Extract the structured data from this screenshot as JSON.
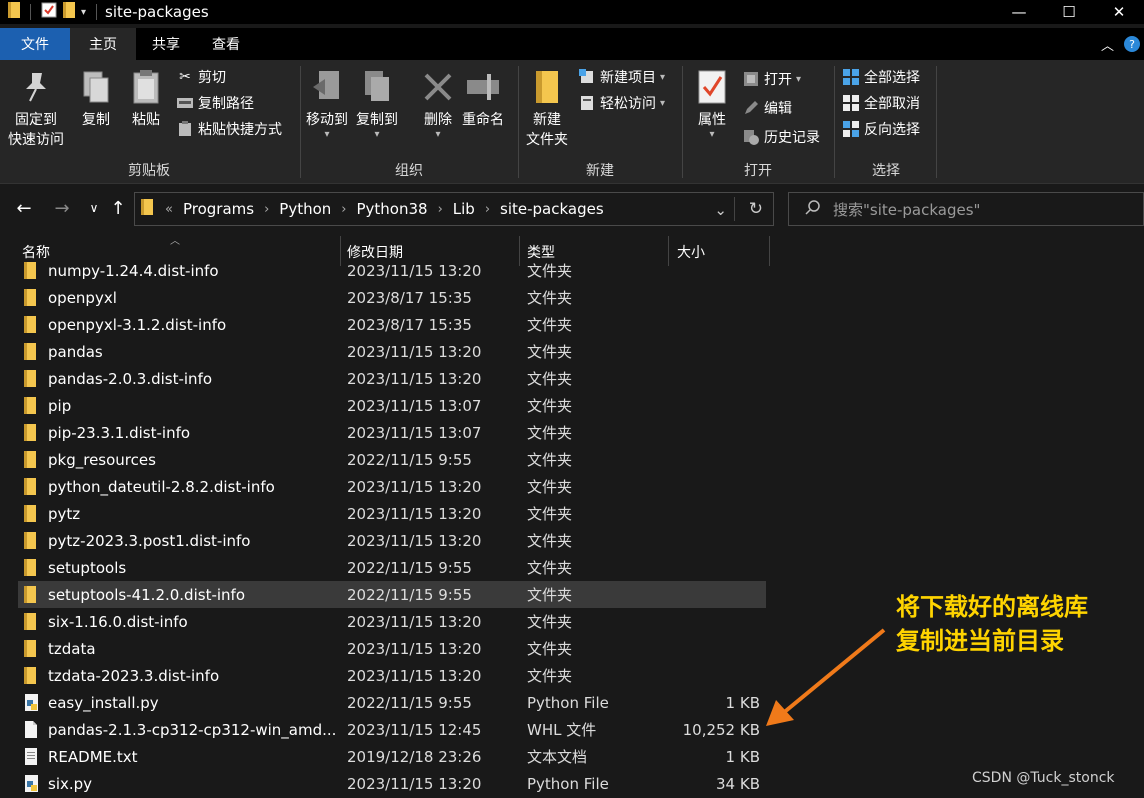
{
  "window": {
    "title": "site-packages",
    "controls": [
      "—",
      "☐",
      "✕"
    ]
  },
  "ribbon_tabs": {
    "file": "文件",
    "home": "主页",
    "share": "共享",
    "view": "查看"
  },
  "ribbon": {
    "clipboard": {
      "label": "剪贴板",
      "pin": "固定到\n快速访问",
      "pin_l1": "固定到",
      "pin_l2": "快速访问",
      "copy": "复制",
      "paste": "粘贴",
      "cut": "剪切",
      "copy_path": "复制路径",
      "paste_shortcut": "粘贴快捷方式"
    },
    "organize": {
      "label": "组织",
      "move_to": "移动到",
      "copy_to": "复制到",
      "delete": "删除",
      "rename": "重命名"
    },
    "new": {
      "label": "新建",
      "new_folder_l1": "新建",
      "new_folder_l2": "文件夹",
      "new_item": "新建项目",
      "easy_access": "轻松访问"
    },
    "open": {
      "label": "打开",
      "properties": "属性",
      "open": "打开",
      "edit": "编辑",
      "history": "历史记录"
    },
    "select": {
      "label": "选择",
      "select_all": "全部选择",
      "select_none": "全部取消",
      "invert": "反向选择"
    }
  },
  "address": {
    "prefix": "«",
    "crumbs": [
      "Programs",
      "Python",
      "Python38",
      "Lib",
      "site-packages"
    ]
  },
  "search": {
    "placeholder": "搜索\"site-packages\""
  },
  "columns": {
    "name": "名称",
    "date": "修改日期",
    "type": "类型",
    "size": "大小"
  },
  "files": [
    {
      "name": "numpy-1.24.4.dist-info",
      "date": "2023/11/15 13:20",
      "type": "文件夹",
      "size": "",
      "kind": "folder"
    },
    {
      "name": "openpyxl",
      "date": "2023/8/17 15:35",
      "type": "文件夹",
      "size": "",
      "kind": "folder"
    },
    {
      "name": "openpyxl-3.1.2.dist-info",
      "date": "2023/8/17 15:35",
      "type": "文件夹",
      "size": "",
      "kind": "folder"
    },
    {
      "name": "pandas",
      "date": "2023/11/15 13:20",
      "type": "文件夹",
      "size": "",
      "kind": "folder"
    },
    {
      "name": "pandas-2.0.3.dist-info",
      "date": "2023/11/15 13:20",
      "type": "文件夹",
      "size": "",
      "kind": "folder"
    },
    {
      "name": "pip",
      "date": "2023/11/15 13:07",
      "type": "文件夹",
      "size": "",
      "kind": "folder"
    },
    {
      "name": "pip-23.3.1.dist-info",
      "date": "2023/11/15 13:07",
      "type": "文件夹",
      "size": "",
      "kind": "folder"
    },
    {
      "name": "pkg_resources",
      "date": "2022/11/15 9:55",
      "type": "文件夹",
      "size": "",
      "kind": "folder"
    },
    {
      "name": "python_dateutil-2.8.2.dist-info",
      "date": "2023/11/15 13:20",
      "type": "文件夹",
      "size": "",
      "kind": "folder"
    },
    {
      "name": "pytz",
      "date": "2023/11/15 13:20",
      "type": "文件夹",
      "size": "",
      "kind": "folder"
    },
    {
      "name": "pytz-2023.3.post1.dist-info",
      "date": "2023/11/15 13:20",
      "type": "文件夹",
      "size": "",
      "kind": "folder"
    },
    {
      "name": "setuptools",
      "date": "2022/11/15 9:55",
      "type": "文件夹",
      "size": "",
      "kind": "folder"
    },
    {
      "name": "setuptools-41.2.0.dist-info",
      "date": "2022/11/15 9:55",
      "type": "文件夹",
      "size": "",
      "kind": "folder",
      "selected": true
    },
    {
      "name": "six-1.16.0.dist-info",
      "date": "2023/11/15 13:20",
      "type": "文件夹",
      "size": "",
      "kind": "folder"
    },
    {
      "name": "tzdata",
      "date": "2023/11/15 13:20",
      "type": "文件夹",
      "size": "",
      "kind": "folder"
    },
    {
      "name": "tzdata-2023.3.dist-info",
      "date": "2023/11/15 13:20",
      "type": "文件夹",
      "size": "",
      "kind": "folder"
    },
    {
      "name": "easy_install.py",
      "date": "2022/11/15 9:55",
      "type": "Python File",
      "size": "1 KB",
      "kind": "python"
    },
    {
      "name": "pandas-2.1.3-cp312-cp312-win_amd...",
      "date": "2023/11/15 12:45",
      "type": "WHL 文件",
      "size": "10,252 KB",
      "kind": "file"
    },
    {
      "name": "README.txt",
      "date": "2019/12/18 23:26",
      "type": "文本文档",
      "size": "1 KB",
      "kind": "text"
    },
    {
      "name": "six.py",
      "date": "2023/11/15 13:20",
      "type": "Python File",
      "size": "34 KB",
      "kind": "python"
    }
  ],
  "annotation": {
    "line1": "将下载好的离线库",
    "line2": "复制进当前目录",
    "color": "#ffd400",
    "arrow_color": "#f07a1a"
  },
  "watermark": "CSDN @Tuck_stonck",
  "colors": {
    "file_tab": "#1c60b0",
    "folder": "#f4c64e",
    "background": "#191919"
  }
}
